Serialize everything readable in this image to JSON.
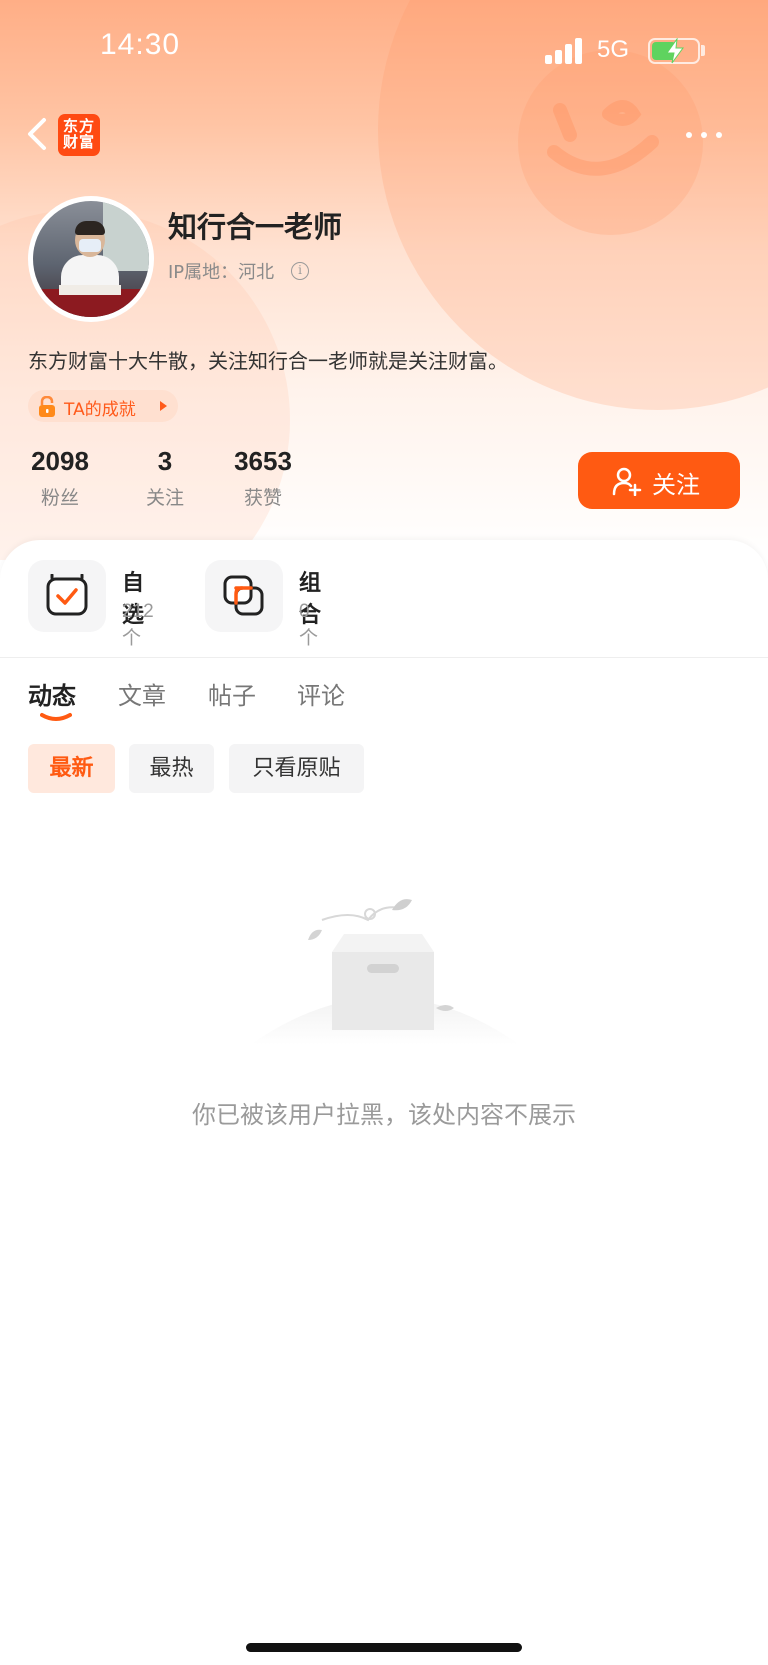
{
  "status_bar": {
    "time": "14:30",
    "network": "5G",
    "battery_level": 0.55,
    "battery_charging": true,
    "icons": [
      "signal-icon",
      "battery-icon",
      "charging-bolt-icon"
    ]
  },
  "nav": {
    "app_logo_line1": "东方",
    "app_logo_line2": "财富",
    "back_icon": "chevron-left-icon",
    "more_icon": "more-dots-icon"
  },
  "profile": {
    "name": "知行合一老师",
    "ip_location": "IP属地：河北",
    "info_icon_glyph": "i",
    "bio": "东方财富十大牛散，关注知行合一老师就是关注财富。",
    "achievement_label": "TA的成就"
  },
  "stats": [
    {
      "value": "2098",
      "label": "粉丝"
    },
    {
      "value": "3",
      "label": "关注"
    },
    {
      "value": "3653",
      "label": "获赞"
    }
  ],
  "follow_button": {
    "label": "关注"
  },
  "features": [
    {
      "title": "自选",
      "count": "212个",
      "icon": "watchlist-check-icon"
    },
    {
      "title": "组合",
      "count": "0个",
      "icon": "portfolio-overlap-icon"
    }
  ],
  "tabs": [
    {
      "label": "动态",
      "active": true
    },
    {
      "label": "文章",
      "active": false
    },
    {
      "label": "帖子",
      "active": false
    },
    {
      "label": "评论",
      "active": false
    }
  ],
  "filters": [
    {
      "label": "最新",
      "active": true
    },
    {
      "label": "最热",
      "active": false
    },
    {
      "label": "只看原贴",
      "active": false
    }
  ],
  "empty_state": {
    "message": "你已被该用户拉黑，该处内容不展示",
    "icon": "empty-box-icon"
  },
  "colors": {
    "accent": "#ff5a12",
    "hero_top": "#ffae86",
    "muted_text": "#9a9a9a"
  }
}
